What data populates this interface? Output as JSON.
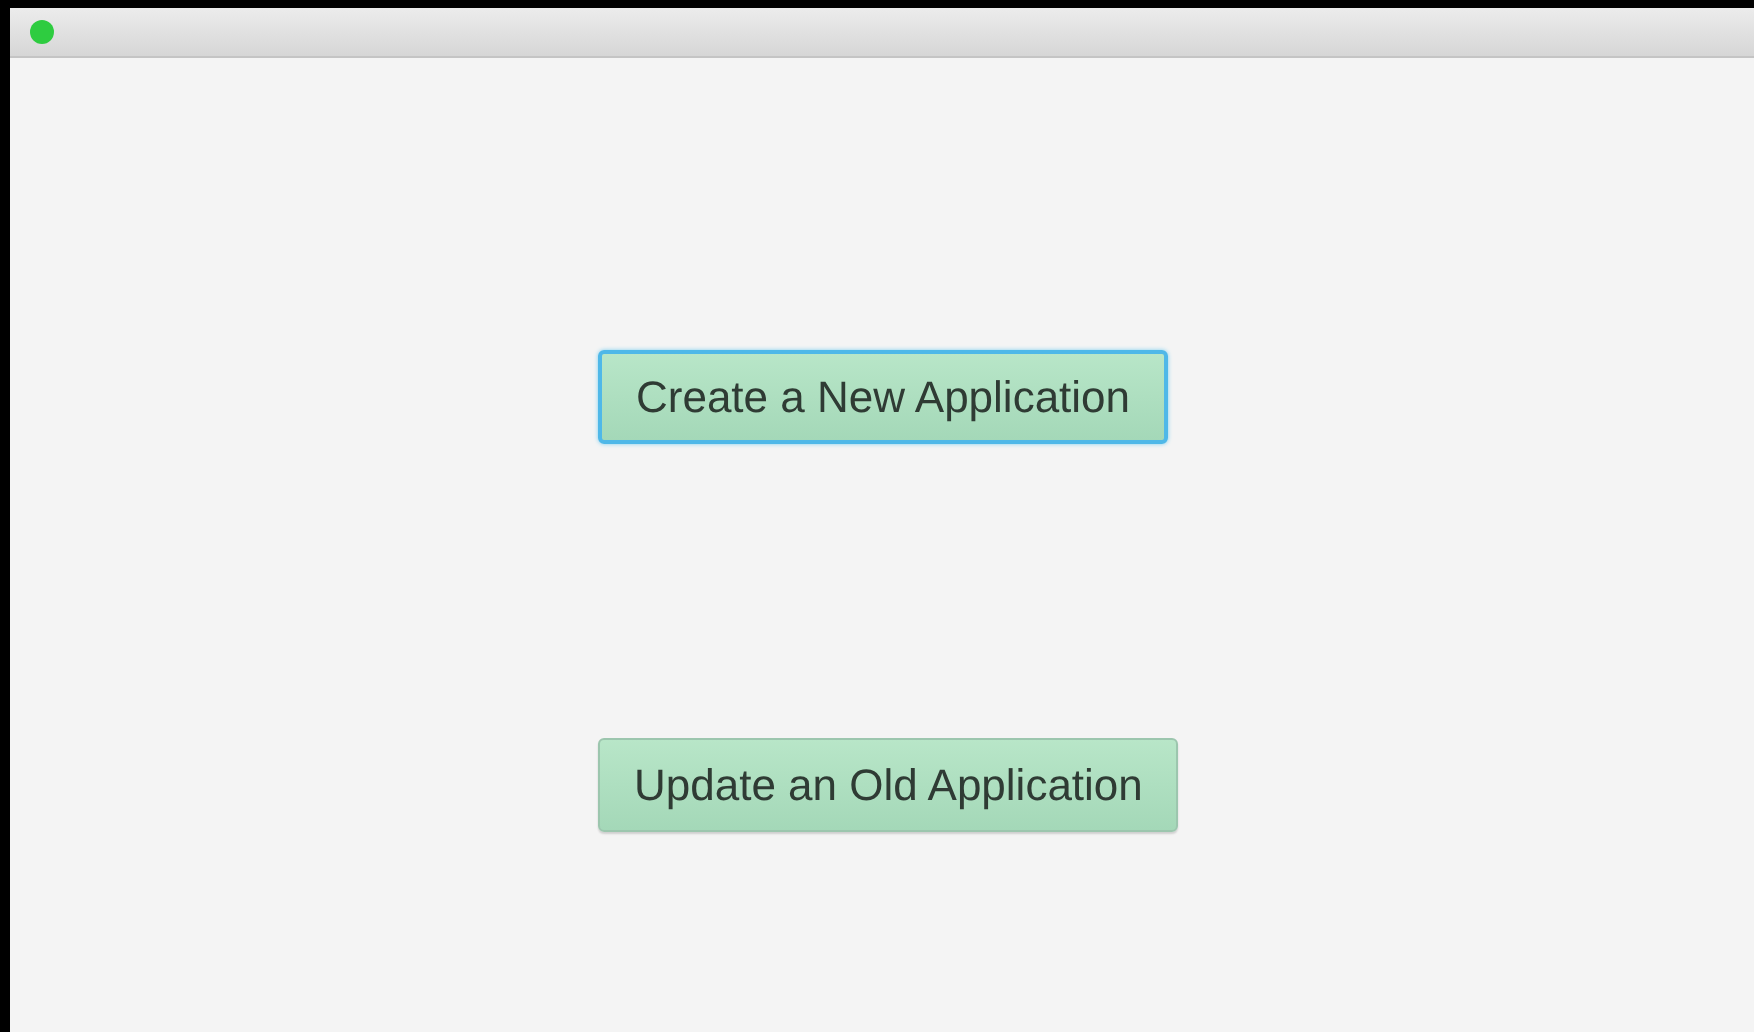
{
  "window": {
    "title_bar": {
      "status_dot": {
        "color": "#2ecc40"
      }
    }
  },
  "buttons": [
    {
      "label": "Create a New Application",
      "focused": true
    },
    {
      "label": "Update an Old Application",
      "focused": false
    }
  ]
}
